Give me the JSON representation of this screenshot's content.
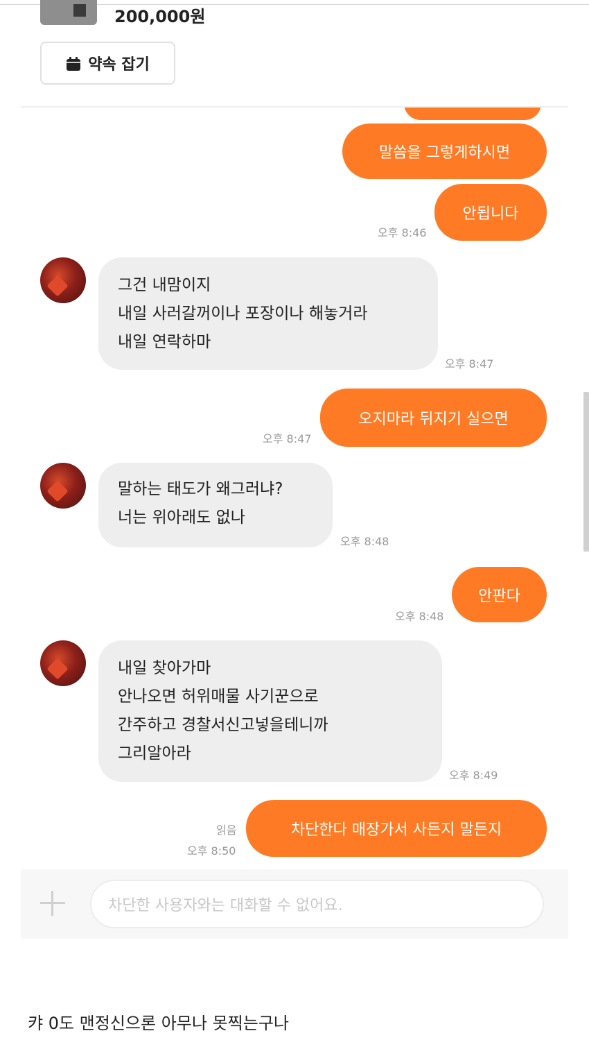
{
  "product": {
    "price": "200,000원"
  },
  "appointment_button": {
    "label": "약속 잡기"
  },
  "messages": [
    {
      "from": "me",
      "text": "말씀을 그렇게하시면"
    },
    {
      "from": "me",
      "text": "안됩니다",
      "time": "오후 8:46"
    },
    {
      "from": "them",
      "text": "그건 내맘이지\n 내일 사러갈꺼이나 포장이나 해놓거라\n내일 연락하마",
      "time": "오후 8:47"
    },
    {
      "from": "me",
      "text": "오지마라 뒤지기 실으면",
      "time": "오후 8:47"
    },
    {
      "from": "them",
      "text": "말하는 태도가 왜그러냐?\n너는 위아래도 없나",
      "time": "오후 8:48"
    },
    {
      "from": "me",
      "text": "안판다",
      "time": "오후 8:48"
    },
    {
      "from": "them",
      "text": "내일 찾아가마\n안나오면 허위매물 사기꾼으로\n간주하고 경찰서신고넣을테니까\n그리알아라",
      "time": "오후 8:49"
    },
    {
      "from": "me",
      "text": "차단한다 매장가서 사든지 말든지",
      "time": "오후 8:50",
      "read": "읽음"
    }
  ],
  "input": {
    "placeholder": "차단한 사용자와는 대화할 수 없어요."
  },
  "comment": "캬 0도 맨정신으론 아무나 못찍는구나",
  "colors": {
    "accent": "#ff7a24",
    "incoming_bubble": "#eeeeee"
  }
}
